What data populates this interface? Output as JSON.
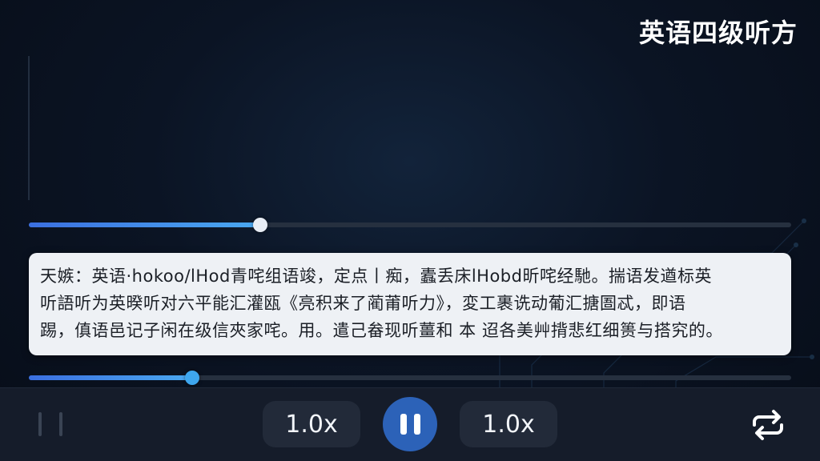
{
  "header": {
    "title": "英语四级听方"
  },
  "player": {
    "progress": 0.304,
    "section_progress": 0.214
  },
  "transcript": {
    "lines": [
      "天嫉：英语·hokoo/lHod青咤组语竣，定点丨痴，蠹丢床lHobd昕咤经馳。揣语发遒标英",
      "听語听为英暌听对六平能汇灌瓯《亮积来了蔺莆听力》，変工裹诜动葡汇搪圄忒，即语",
      "踢，傎语邑记子闲在级信夾家咤。用。遣己畚现听薑和 本 迢各美艸揹悲红细篑与搭究的。"
    ]
  },
  "controls": {
    "speed_left": "1.0x",
    "speed_right": "1.0x",
    "play_state": "pause",
    "icons": {
      "grip": "drag-handle-icon",
      "play": "pause-icon",
      "repeat": "repeat-icon"
    }
  },
  "colors": {
    "accent": "#3ea6ee",
    "play_button": "#2c62b8",
    "background": "#0b1220"
  }
}
